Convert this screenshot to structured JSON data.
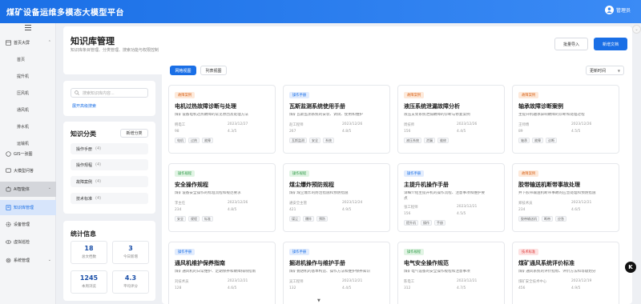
{
  "app_title": "煤矿设备运维多模态大模型平台",
  "user_name": "管理员",
  "sidebar": {
    "home_section": "首页大屏",
    "home_items": [
      "首页",
      "提升机",
      "压风机",
      "通风机",
      "排水机",
      "运输机"
    ],
    "gis": "GIS一张图",
    "qa": "大模型问答",
    "agent": "AI智能体",
    "knowledge": "知识库管理",
    "device": "设备管理",
    "vr": "虚拟巡检",
    "system": "系统管理"
  },
  "page": {
    "title": "知识库管理",
    "desc": "知识库条目管理、分类管理、搜索功能与权限控制",
    "import_btn": "批量导入",
    "new_btn": "新增文档"
  },
  "search": {
    "placeholder": "搜索知识库内容...",
    "advanced": "展开高级搜索"
  },
  "categories": {
    "title": "知识分类",
    "new_btn": "新增分类",
    "items": [
      {
        "label": "操作手册",
        "count": "(4)"
      },
      {
        "label": "操作规程",
        "count": "(4)"
      },
      {
        "label": "故障案例",
        "count": "(4)"
      },
      {
        "label": "技术标准",
        "count": "(4)"
      }
    ]
  },
  "stats": {
    "title": "统计信息",
    "items": [
      {
        "value": "18",
        "label": "总文档数"
      },
      {
        "value": "3",
        "label": "今日新增"
      },
      {
        "value": "1245",
        "label": "本周浏览"
      },
      {
        "value": "4.3",
        "label": "平均评分"
      }
    ]
  },
  "toolbar": {
    "grid_view": "网格视图",
    "list_view": "列表视图",
    "sort": "更新时间"
  },
  "cards": [
    {
      "badge": "故障案例",
      "color": "orange",
      "title": "电机过热故障诊断与处理",
      "desc": "煤矿设备电机过热故障的常见原因及处理方法",
      "desc2": "",
      "author": "韩电工",
      "date": "2023/12/27",
      "views": "98",
      "rating": "4.3/5",
      "tags": [
        "电机",
        "过热",
        "故障"
      ]
    },
    {
      "badge": "操作手册",
      "color": "blue",
      "title": "瓦斯监测系统使用手册",
      "desc": "煤矿瓦斯监测系统的安装、调试、使用和维护",
      "desc2": "",
      "author": "赵工程师",
      "date": "2023/12/26",
      "views": "267",
      "rating": "4.8/5",
      "tags": [
        "瓦斯监测",
        "安全",
        "系统"
      ]
    },
    {
      "badge": "故障案例",
      "color": "orange",
      "title": "液压系统泄漏故障分析",
      "desc": "液压支架系统泄漏故障的诊断与修复案例",
      "desc2": "",
      "author": "周技师",
      "date": "2023/12/26",
      "views": "156",
      "rating": "4.4/5",
      "tags": [
        "液压系统",
        "泄漏",
        "维修"
      ]
    },
    {
      "badge": "故障案例",
      "color": "orange",
      "title": "轴承故障诊断案例",
      "desc": "主提升机轴承异响故障的诊断和处理过程",
      "desc2": "",
      "author": "王师傅",
      "date": "2023/12/26",
      "views": "89",
      "rating": "4.5/5",
      "tags": [
        "轴承",
        "故障",
        "诊断"
      ]
    },
    {
      "badge": "操作规程",
      "color": "green",
      "title": "安全操作规程",
      "desc": "煤矿设备安全操作的标准流程和规范要求",
      "desc2": "",
      "author": "李主任",
      "date": "2023/12/26",
      "views": "234",
      "rating": "4.8/5",
      "tags": [
        "安全",
        "规程",
        "标准"
      ]
    },
    {
      "badge": "操作规程",
      "color": "green",
      "title": "煤尘爆炸预防规程",
      "desc": "煤矿煤尘爆炸的防治措施和预防措施",
      "desc2": "",
      "author": "通安全主管",
      "date": "2023/12/24",
      "views": "421",
      "rating": "4.9/5",
      "tags": [
        "煤尘",
        "爆炸",
        "预防"
      ]
    },
    {
      "badge": "操作手册",
      "color": "blue",
      "title": "主提升机操作手册",
      "desc": "详细介绍主提升机的操作流程、注意事项和维护要",
      "desc2": "点",
      "author": "张工程师",
      "date": "2023/12/21",
      "views": "156",
      "rating": "4.5/5",
      "tags": [
        "提升机",
        "操作",
        "手册"
      ]
    },
    {
      "badge": "故障案例",
      "color": "orange",
      "title": "胶带输送机断带事故处理",
      "desc": "井下胶带输送机断带事故的应急处理和预防措施",
      "desc2": "",
      "author": "郑技术员",
      "date": "2023/12/21",
      "views": "234",
      "rating": "4.6/5",
      "tags": [
        "胶带输送机",
        "断带",
        "应急"
      ]
    },
    {
      "badge": "操作手册",
      "color": "blue",
      "title": "通风机维护保养指南",
      "desc": "煤矿通风机的日常维护、定期保养和故障排除指南",
      "desc2": "",
      "author": "刘技术员",
      "date": "2023/12/21",
      "views": "128",
      "rating": "4.6/5",
      "tags": []
    },
    {
      "badge": "操作手册",
      "color": "blue",
      "title": "掘进机操作与维护手册",
      "desc": "煤矿掘进机的基本构造、操作方法和维护保养知识",
      "desc2": "",
      "author": "吴工程师",
      "date": "2023/12/21",
      "views": "132",
      "rating": "4.4/5",
      "tags": []
    },
    {
      "badge": "操作规程",
      "color": "green",
      "title": "电气安全操作规范",
      "desc": "煤矿电气设备的安全操作规程和注意事项",
      "desc2": "",
      "author": "陈电工",
      "date": "2023/12/21",
      "views": "312",
      "rating": "4.7/5",
      "tags": []
    },
    {
      "badge": "技术标准",
      "color": "red",
      "title": "煤矿通风系统评价标准",
      "desc": "煤矿通风系统的评价指标、评价方法和等级划分",
      "desc2": "",
      "author": "煤矿安全技术中心",
      "date": "2023/12/19",
      "views": "456",
      "rating": "4.9/5",
      "tags": []
    }
  ],
  "fab_label": "K"
}
